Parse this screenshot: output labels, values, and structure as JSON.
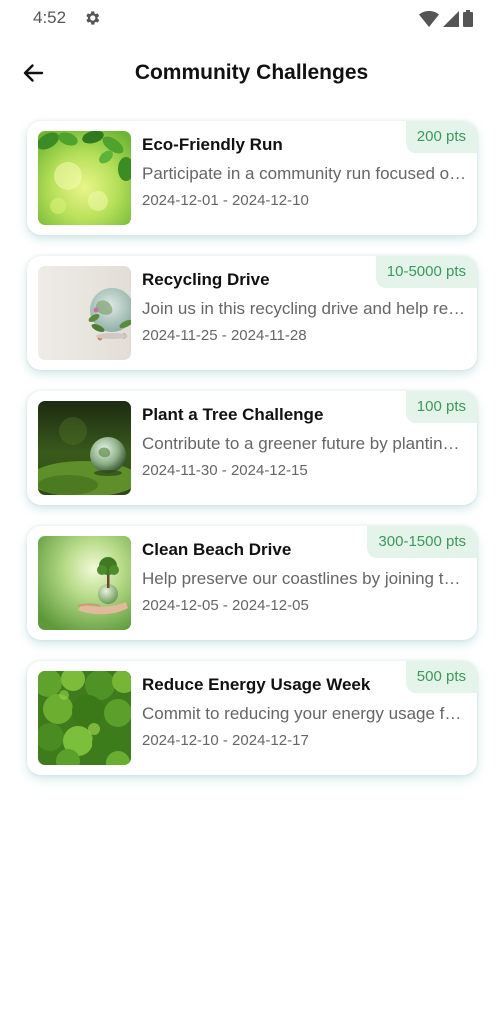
{
  "status_bar": {
    "time": "4:52",
    "icons": [
      "settings-gear-icon",
      "wifi-icon",
      "cell-signal-icon",
      "battery-icon"
    ]
  },
  "app_bar": {
    "back_icon": "arrow-back-icon",
    "title": "Community Challenges"
  },
  "colors": {
    "badge_bg": "#e4f4ea",
    "badge_text": "#3a9a5a",
    "card_shadow": "#5aaaaa"
  },
  "challenges": [
    {
      "title": "Eco-Friendly Run",
      "description": "Participate in a community run focused on sustainability.",
      "dates": "2024-12-01 - 2024-12-10",
      "points": "200 pts",
      "image": "green-leaves-bokeh"
    },
    {
      "title": "Recycling Drive",
      "description": "Join us in this recycling drive and help reduce waste.",
      "dates": "2024-11-25 - 2024-11-28",
      "points": "10-5000 pts",
      "image": "earth-globe-with-plants"
    },
    {
      "title": "Plant a Tree Challenge",
      "description": "Contribute to a greener future by planting trees.",
      "dates": "2024-11-30 - 2024-12-15",
      "points": "100 pts",
      "image": "glass-globe-on-moss"
    },
    {
      "title": "Clean Beach Drive",
      "description": "Help preserve our coastlines by joining the beach cleanup.",
      "dates": "2024-12-05 - 2024-12-05",
      "points": "300-1500 pts",
      "image": "hand-holding-tree-globe"
    },
    {
      "title": "Reduce Energy Usage Week",
      "description": "Commit to reducing your energy usage for a week.",
      "dates": "2024-12-10 - 2024-12-17",
      "points": "500 pts",
      "image": "green-forest-canopy"
    }
  ]
}
